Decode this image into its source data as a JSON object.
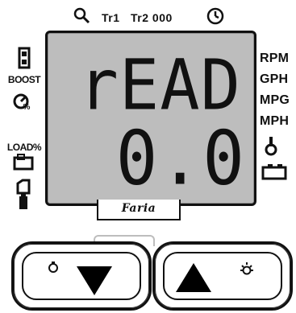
{
  "top": {
    "icons": {
      "search": "search-icon",
      "clock": "clock-icon"
    },
    "tr1": "Tr1",
    "tr2": "Tr2 000"
  },
  "display": {
    "line1": "rEAD",
    "line2": "0.0"
  },
  "brand": {
    "logo": "Faria"
  },
  "left_indicators": {
    "boost": "BOOST",
    "percent": "%",
    "load": "LOAD%"
  },
  "right_indicators": {
    "rpm": "RPM",
    "gph": "GPH",
    "mpg": "MPG",
    "mph": "MPH"
  },
  "buttons": {
    "down": "down",
    "up": "up"
  }
}
